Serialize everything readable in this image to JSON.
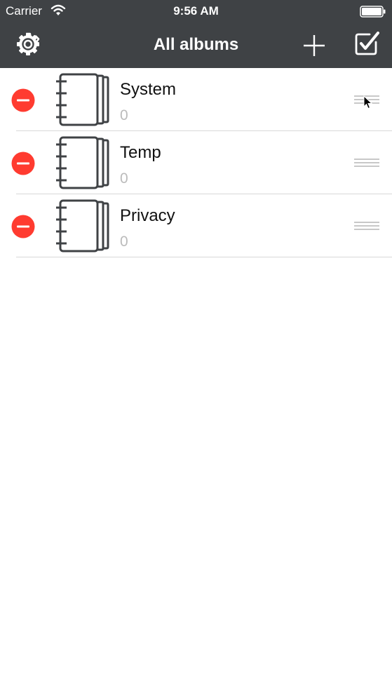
{
  "status_bar": {
    "carrier": "Carrier",
    "time": "9:56 AM"
  },
  "nav": {
    "title": "All albums",
    "left_icon": "gear-icon",
    "right_icons": [
      "plus-icon",
      "checkbox-icon"
    ]
  },
  "albums": [
    {
      "name": "System",
      "count": "0"
    },
    {
      "name": "Temp",
      "count": "0"
    },
    {
      "name": "Privacy",
      "count": "0"
    }
  ],
  "colors": {
    "bar_background": "#3f4245",
    "delete_red": "#ff3b30",
    "separator": "#d8d8d8",
    "count_gray": "#bbbbbb"
  }
}
